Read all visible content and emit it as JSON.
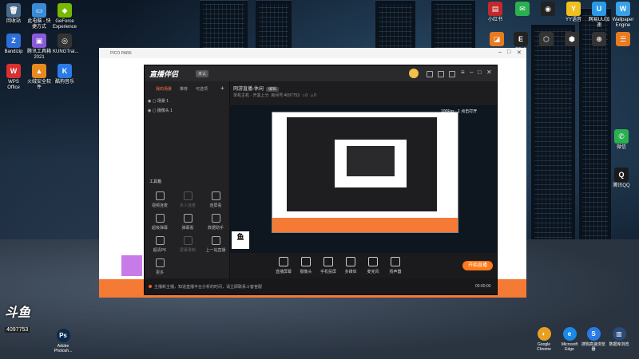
{
  "desktop": {
    "left_icons": [
      {
        "label": "回收站",
        "icon": "recycle-bin-icon",
        "glyph": "🗑",
        "color": "#4a6a8a"
      },
      {
        "label": "此电脑 - 快捷方式",
        "icon": "computer-icon",
        "glyph": "▭",
        "color": "#3a8ad8"
      },
      {
        "label": "GeForce Experience",
        "icon": "geforce-icon",
        "glyph": "◆",
        "color": "#76b900"
      },
      {
        "label": "Bandizip",
        "icon": "bandizip-icon",
        "glyph": "Z",
        "color": "#2d6fd6"
      },
      {
        "label": "腾讯工具箱 2021",
        "icon": "toolbox-icon",
        "glyph": "▣",
        "color": "#8a5ad8"
      },
      {
        "label": "KUNGTrai...",
        "icon": "kung-icon",
        "glyph": "◎",
        "color": "#333"
      },
      {
        "label": "WPS Office",
        "icon": "wps-icon",
        "glyph": "W",
        "color": "#d83030"
      },
      {
        "label": "火绒安全软件",
        "icon": "huorong-icon",
        "glyph": "▲",
        "color": "#e88a20"
      },
      {
        "label": "酷狗音乐",
        "icon": "kugou-icon",
        "glyph": "K",
        "color": "#2a7ae8"
      }
    ],
    "right_icons": [
      {
        "label": "小红书",
        "icon": "xhs-icon",
        "glyph": "▤",
        "color": "#c02a2a"
      },
      {
        "label": "",
        "icon": "green-app-icon",
        "glyph": "✉",
        "color": "#2ab050"
      },
      {
        "label": "",
        "icon": "steam-style-icon",
        "glyph": "◉",
        "color": "#222"
      },
      {
        "label": "YY语音",
        "icon": "yy-icon",
        "glyph": "Y",
        "color": "#f0c020"
      },
      {
        "label": "网易UU加速",
        "icon": "uu-icon",
        "glyph": "U",
        "color": "#2a9ae8"
      },
      {
        "label": "Wallpaper Engine",
        "icon": "wallpaper-engine-icon",
        "glyph": "W",
        "color": "#3aa0e8"
      },
      {
        "label": "EPIC",
        "icon": "epic-icon",
        "glyph": "E",
        "color": "#222"
      },
      {
        "label": "",
        "icon": "app-icon",
        "glyph": "⬡",
        "color": "#333"
      },
      {
        "label": "",
        "icon": "app-icon-2",
        "glyph": "⬢",
        "color": "#333"
      },
      {
        "label": "",
        "icon": "app-icon-3",
        "glyph": "⊕",
        "color": "#333"
      },
      {
        "label": "",
        "icon": "app-icon-4",
        "glyph": "☰",
        "color": "#e87a20"
      },
      {
        "label": "",
        "icon": "app-icon-5",
        "glyph": "◪",
        "color": "#e87a20"
      },
      {
        "label": "微信",
        "icon": "wechat-icon",
        "glyph": "✆",
        "color": "#2ab050"
      },
      {
        "label": "腾讯QQ",
        "icon": "qq-icon",
        "glyph": "Q",
        "color": "#1a1a1a"
      }
    ],
    "bottom_icons": [
      {
        "label": "斗鱼",
        "icon": "douyu-icon",
        "glyph": "鱼",
        "color": "#f07a20"
      },
      {
        "label": "Adobe Photosh...",
        "icon": "photoshop-icon",
        "glyph": "Ps",
        "color": "#0a2a4a"
      },
      {
        "label": "Google Chrome",
        "icon": "chrome-icon",
        "glyph": "◐",
        "color": "#e8a020"
      },
      {
        "label": "Microsoft Edge",
        "icon": "edge-icon",
        "glyph": "e",
        "color": "#1a8ae8"
      },
      {
        "label": "搜狗高速浏览器",
        "icon": "sogou-icon",
        "glyph": "S",
        "color": "#2a7ae8"
      },
      {
        "label": "数据库浏览",
        "icon": "database-icon",
        "glyph": "▥",
        "color": "#2a4a7a"
      }
    ],
    "douyu_id": "4097753"
  },
  "obs_window": {
    "title": "PICO PARK",
    "min": "–",
    "max": "□",
    "close": "✕"
  },
  "app": {
    "brand": "直播伴侣",
    "badge": "未认",
    "tabs": [
      "我的场景",
      "推荐",
      "可选项"
    ],
    "add": "+",
    "scenes": [
      "场景 1",
      "摄像头 1"
    ],
    "toolbox_title": "工具箱",
    "tools": [
      {
        "label": "视频连麦",
        "icon": "video-link-icon",
        "dim": false
      },
      {
        "label": "多人连麦",
        "icon": "multi-link-icon",
        "dim": true
      },
      {
        "label": "连屏看",
        "icon": "co-watch-icon",
        "dim": false
      },
      {
        "label": "超级弹幕",
        "icon": "super-danmu-icon",
        "dim": false
      },
      {
        "label": "弹幕看",
        "icon": "danmu-view-icon",
        "dim": false
      },
      {
        "label": "数据助手",
        "icon": "data-helper-icon",
        "dim": false
      },
      {
        "label": "超清PK",
        "icon": "pk-icon",
        "dim": false
      },
      {
        "label": "屏幕录制",
        "icon": "screen-record-icon",
        "dim": true
      },
      {
        "label": "上一站直播",
        "icon": "prev-live-icon",
        "dim": false
      },
      {
        "label": "更多",
        "icon": "more-icon",
        "dim": false
      }
    ],
    "room_title": "网游直播-休闲",
    "room_pill": "编辑",
    "meta": {
      "category": "单机主机 · 开黑上分",
      "room_label": "房间号:",
      "room_id": "4097753",
      "like_count": "0",
      "view_count": "0"
    },
    "controls": [
      {
        "label": "直播屏幕",
        "icon": "screen-icon"
      },
      {
        "label": "摄像头",
        "icon": "camera-icon"
      },
      {
        "label": "手机投屏",
        "icon": "phone-cast-icon"
      },
      {
        "label": "多媒体",
        "icon": "media-icon"
      },
      {
        "label": "麦克风",
        "icon": "mic-icon"
      },
      {
        "label": "扬声器",
        "icon": "speaker-icon"
      }
    ],
    "live_button": "开始直播",
    "notice": "主播新主播，知道直播平台分析的时间，请立即联系斗客官服",
    "time": "00:00:00",
    "preview_tag": "100Fps · 1 点击打开"
  },
  "colors": {
    "accent": "#ff7a1a",
    "tab_active": "#ff7a3a",
    "obs_bar": "#f47a35"
  }
}
